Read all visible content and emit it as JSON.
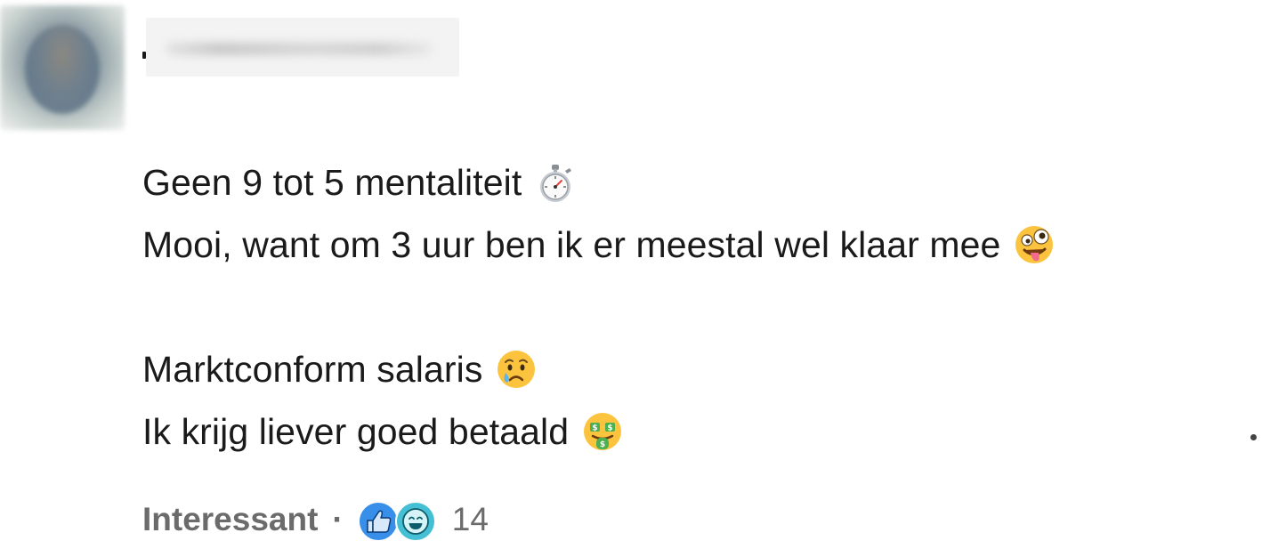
{
  "comment": {
    "lines": [
      "Geen 9 tot 5 mentaliteit",
      "Mooi, want om 3 uur ben ik er meestal wel klaar mee",
      "Marktconform salaris",
      "Ik krijg liever goed betaald"
    ],
    "emojis": [
      "stopwatch-icon",
      "zany-face-icon",
      "crying-face-icon",
      "money-mouth-face-icon"
    ]
  },
  "footer": {
    "reaction_label": "Interessant",
    "separator": "·",
    "reaction_icons": [
      "like-icon",
      "funny-icon"
    ],
    "reaction_count": "14"
  },
  "colors": {
    "text": "#1a1a1a",
    "muted": "#6b6b6b",
    "like_blue": "#378fe9",
    "funny_teal": "#44bfd3"
  }
}
